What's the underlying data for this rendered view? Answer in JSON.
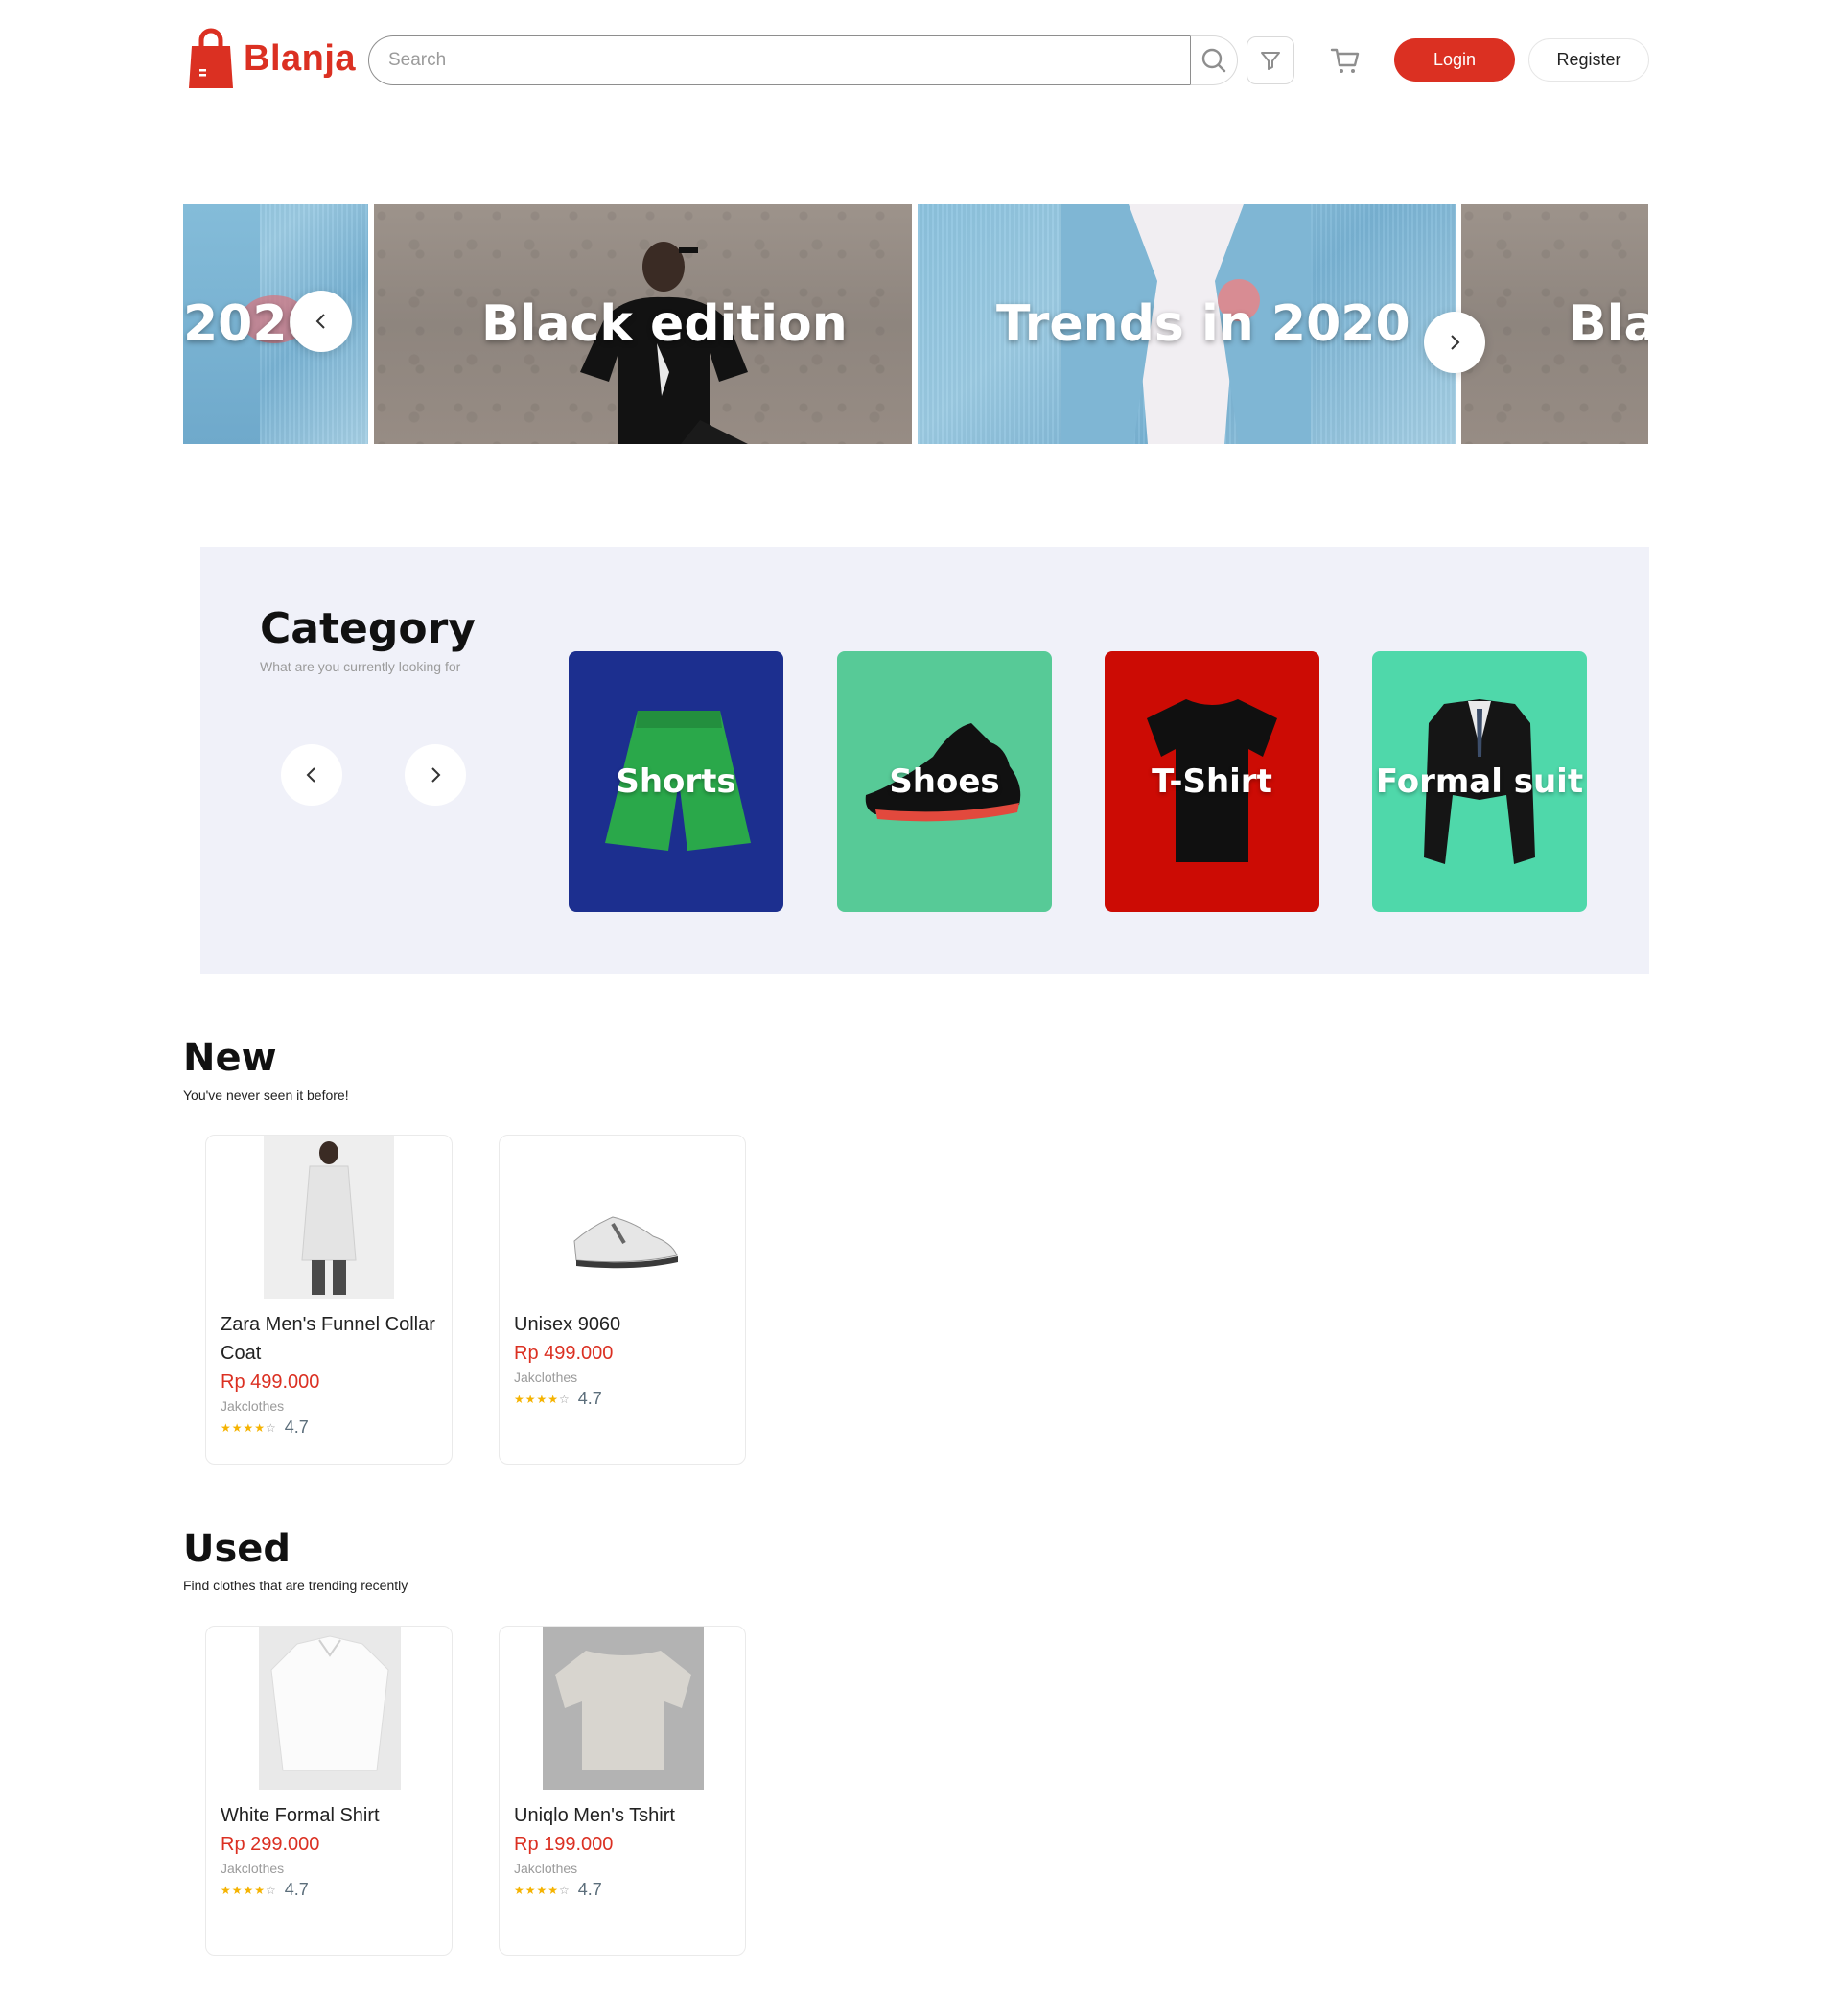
{
  "brand": {
    "name": "Blanja",
    "color": "#DB3022"
  },
  "header": {
    "search_placeholder": "Search",
    "login_label": "Login",
    "register_label": "Register"
  },
  "hero": {
    "slides": [
      {
        "label": "2020"
      },
      {
        "label": "Black edition"
      },
      {
        "label": "Trends in 2020"
      },
      {
        "label": "Bla"
      }
    ]
  },
  "category": {
    "title": "Category",
    "subtitle": "What are you currently looking for",
    "items": [
      {
        "label": "Shorts",
        "color": "#1c2f8f"
      },
      {
        "label": "Shoes",
        "color": "#57ca97"
      },
      {
        "label": "T-Shirt",
        "color": "#cc0b04"
      },
      {
        "label": "Formal suit",
        "color": "#4fd8aa"
      }
    ]
  },
  "new_section": {
    "title": "New",
    "subtitle": "You've never seen it before!",
    "products": [
      {
        "name": "Zara Men's Funnel Collar Coat",
        "price": "Rp 499.000",
        "store": "Jakclothes",
        "rating": "4.7",
        "stars_filled": 4
      },
      {
        "name": "Unisex 9060",
        "price": "Rp 499.000",
        "store": "Jakclothes",
        "rating": "4.7",
        "stars_filled": 4
      }
    ]
  },
  "used_section": {
    "title": "Used",
    "subtitle": "Find clothes that are trending recently",
    "products": [
      {
        "name": "White Formal Shirt",
        "price": "Rp 299.000",
        "store": "Jakclothes",
        "rating": "4.7",
        "stars_filled": 4
      },
      {
        "name": "Uniqlo Men's Tshirt",
        "price": "Rp 199.000",
        "store": "Jakclothes",
        "rating": "4.7",
        "stars_filled": 4
      }
    ]
  }
}
